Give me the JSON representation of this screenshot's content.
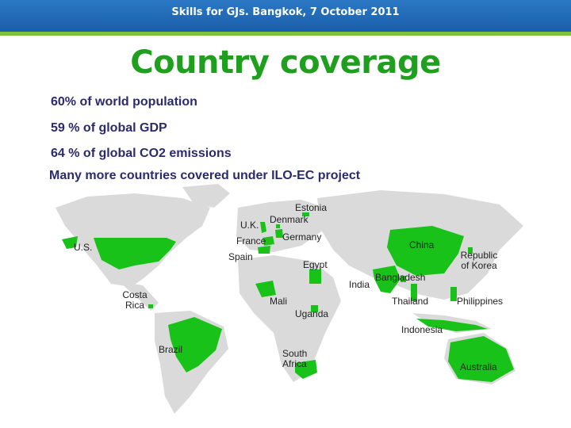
{
  "header": {
    "text": "Skills for GJs. Bangkok, 7 October 2011"
  },
  "title": "Country coverage",
  "bullets": [
    "60% of world population",
    "59 % of global GDP",
    "64 % of global CO2 emissions",
    "Many more countries covered under ILO-EC project"
  ],
  "colors": {
    "header": "#1f66b2",
    "accent": "#7ec33a",
    "title": "#1ea01e",
    "covered": "#19c219",
    "land": "#d9d9d9"
  },
  "map": {
    "labels": {
      "estonia": "Estonia",
      "denmark": "Denmark",
      "uk": "U.K.",
      "germany": "Germany",
      "france": "France",
      "us": "U.S.",
      "spain": "Spain",
      "china": "China",
      "korea": "Republic of Korea",
      "egypt": "Egypt",
      "bangladesh": "Bangladesh",
      "india": "India",
      "costa_rica": "Costa Rica",
      "mali": "Mali",
      "thailand": "Thailand",
      "philippines": "Philippines",
      "uganda": "Uganda",
      "indonesia": "Indonesia",
      "brazil": "Brazil",
      "south_africa": "South Africa",
      "australia": "Australia"
    }
  }
}
